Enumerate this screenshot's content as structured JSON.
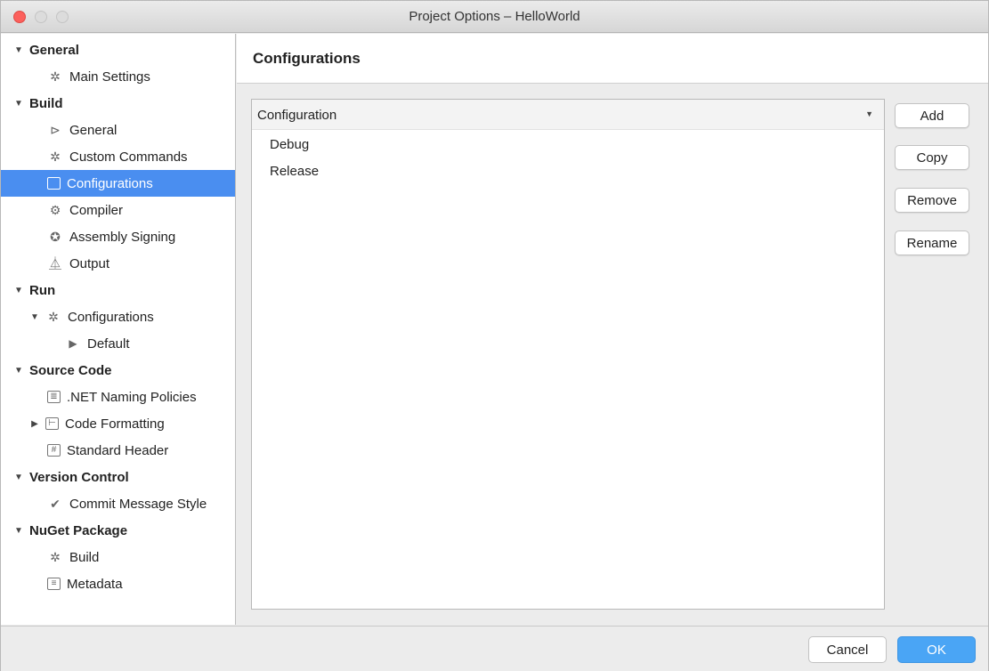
{
  "window": {
    "title": "Project Options – HelloWorld"
  },
  "sidebar": {
    "items": [
      {
        "label": "General",
        "level": 0,
        "group": true,
        "expanded": true,
        "icon": ""
      },
      {
        "label": "Main Settings",
        "level": 1,
        "icon": "gear-icon"
      },
      {
        "label": "Build",
        "level": 0,
        "group": true,
        "expanded": true,
        "icon": ""
      },
      {
        "label": "General",
        "level": 1,
        "icon": "build-general-icon"
      },
      {
        "label": "Custom Commands",
        "level": 1,
        "icon": "gear-icon"
      },
      {
        "label": "Configurations",
        "level": 1,
        "icon": "window-icon",
        "selected": true
      },
      {
        "label": "Compiler",
        "level": 1,
        "icon": "compiler-icon"
      },
      {
        "label": "Assembly Signing",
        "level": 1,
        "icon": "badge-icon"
      },
      {
        "label": "Output",
        "level": 1,
        "icon": "flask-icon"
      },
      {
        "label": "Run",
        "level": 0,
        "group": true,
        "expanded": true,
        "icon": ""
      },
      {
        "label": "Configurations",
        "level": 1,
        "icon": "gear-icon",
        "expanded": true
      },
      {
        "label": "Default",
        "level": 2,
        "icon": "play-icon"
      },
      {
        "label": "Source Code",
        "level": 0,
        "group": true,
        "expanded": true,
        "icon": ""
      },
      {
        "label": ".NET Naming Policies",
        "level": 1,
        "icon": "naming-policies-icon"
      },
      {
        "label": "Code Formatting",
        "level": 1,
        "icon": "code-formatting-icon",
        "expanded": false
      },
      {
        "label": "Standard Header",
        "level": 1,
        "icon": "header-icon"
      },
      {
        "label": "Version Control",
        "level": 0,
        "group": true,
        "expanded": true,
        "icon": ""
      },
      {
        "label": "Commit Message Style",
        "level": 1,
        "icon": "check-circle-icon"
      },
      {
        "label": "NuGet Package",
        "level": 0,
        "group": true,
        "expanded": true,
        "icon": ""
      },
      {
        "label": "Build",
        "level": 1,
        "icon": "gear-icon"
      },
      {
        "label": "Metadata",
        "level": 1,
        "icon": "document-icon"
      }
    ]
  },
  "panel": {
    "title": "Configurations",
    "list_header": "Configuration",
    "configurations": [
      "Debug",
      "Release"
    ],
    "buttons": {
      "add": "Add",
      "copy": "Copy",
      "remove": "Remove",
      "rename": "Rename"
    }
  },
  "footer": {
    "cancel": "Cancel",
    "ok": "OK"
  },
  "colors": {
    "selection": "#4a8ef0",
    "ok_button": "#4aa5f5",
    "close_button": "#fc605c"
  }
}
